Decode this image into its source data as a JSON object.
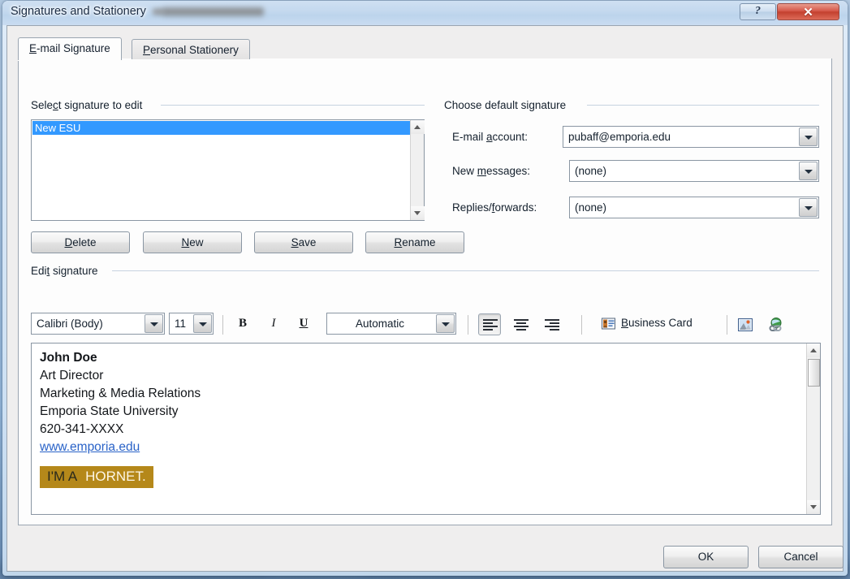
{
  "window": {
    "title": "Signatures and Stationery",
    "help_button": "?",
    "close_button": "✕"
  },
  "tabs": [
    {
      "label": "E-mail Signature",
      "accel": "E",
      "active": true
    },
    {
      "label": "Personal Stationery",
      "accel": "P",
      "active": false
    }
  ],
  "select_signature": {
    "group_label": "Select signature to edit",
    "group_accel": "c",
    "items": [
      {
        "name": "New ESU",
        "selected": true
      }
    ],
    "buttons": [
      {
        "label": "Delete",
        "accel": "D"
      },
      {
        "label": "New",
        "accel": "N"
      },
      {
        "label": "Save",
        "accel": "S"
      },
      {
        "label": "Rename",
        "accel": "R"
      }
    ]
  },
  "default_signature": {
    "group_label": "Choose default signature",
    "fields": [
      {
        "label": "E-mail account:",
        "accel": "a",
        "value": "pubaff@emporia.edu"
      },
      {
        "label": "New messages:",
        "accel": "m",
        "value": "(none)"
      },
      {
        "label": "Replies/forwards:",
        "accel": "f",
        "value": "(none)"
      }
    ]
  },
  "edit_signature": {
    "group_label": "Edit signature",
    "group_accel": "t",
    "toolbar": {
      "font_family": "Calibri (Body)",
      "font_size": "11",
      "bold": "B",
      "italic": "I",
      "underline": "U",
      "font_color": "Automatic",
      "align_left": "align-left-icon",
      "align_center": "align-center-icon",
      "align_right": "align-right-icon",
      "business_card_label": "Business Card",
      "business_card_accel": "B",
      "picture_icon": "insert-picture-icon",
      "hyperlink_icon": "insert-hyperlink-icon"
    },
    "content": {
      "lines": [
        {
          "text": "John Doe",
          "style": "bold"
        },
        {
          "text": "Art Director",
          "style": "normal"
        },
        {
          "text": "Marketing & Media Relations",
          "style": "normal"
        },
        {
          "text": "Emporia State University",
          "style": "normal"
        },
        {
          "text": "620-341-XXXX",
          "style": "normal"
        },
        {
          "text": "www.emporia.edu",
          "style": "hyperlink"
        }
      ],
      "banner": {
        "text_dark": "I'M A",
        "text_light": "HORNET.",
        "background_color": "#b5881a",
        "dark_color": "#2b2a1c",
        "light_color": "#fdf6e6"
      }
    }
  },
  "footer": {
    "ok": "OK",
    "cancel": "Cancel"
  },
  "colors": {
    "selection_blue": "#3399ff",
    "hyperlink_blue": "#2a63c8",
    "dialog_face": "#efeeee",
    "panel_white": "#fdfdfd",
    "close_red": "#c3402f"
  }
}
